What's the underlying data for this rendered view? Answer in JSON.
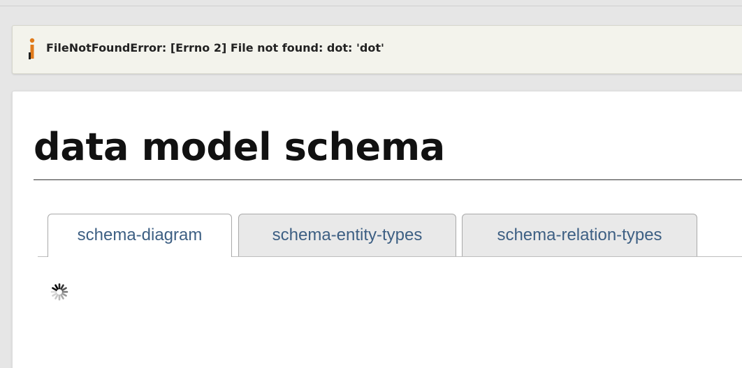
{
  "notification": {
    "message": "FileNotFoundError: [Errno 2] File not found: dot: 'dot'",
    "icon": "info-icon",
    "icon_color": "#e07a1a"
  },
  "main": {
    "title": "data model schema",
    "tabs": [
      {
        "label": "schema-diagram",
        "active": true
      },
      {
        "label": "schema-entity-types",
        "active": false
      },
      {
        "label": "schema-relation-types",
        "active": false
      }
    ],
    "loading_indicator": "loading-spinner-icon"
  },
  "colors": {
    "tab_text": "#3d5f83",
    "page_background": "#e6e6e6",
    "panel_background": "#ffffff"
  }
}
